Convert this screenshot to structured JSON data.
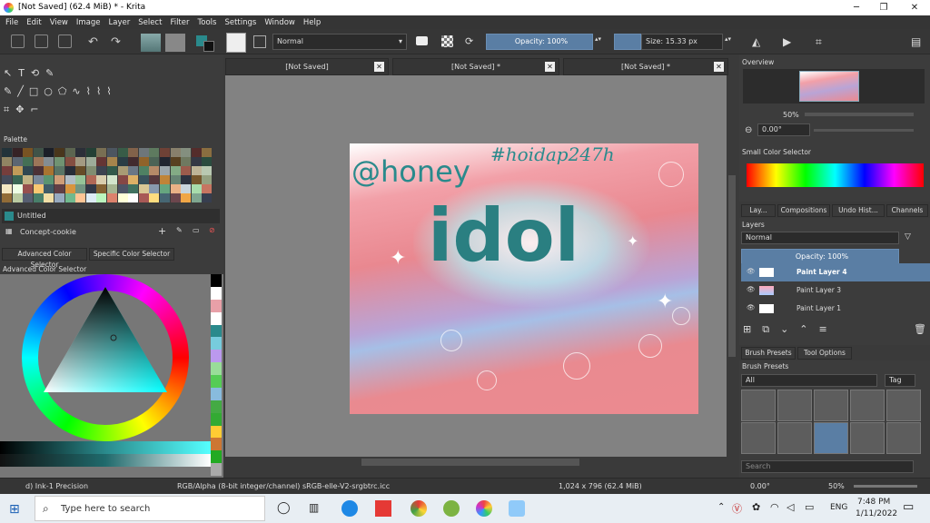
{
  "window": {
    "title": "[Not Saved]  (62.4 MiB)  * - Krita"
  },
  "menu": [
    "File",
    "Edit",
    "View",
    "Image",
    "Layer",
    "Select",
    "Filter",
    "Tools",
    "Settings",
    "Window",
    "Help"
  ],
  "toolbar": {
    "blend_mode": "Normal",
    "opacity": "Opacity: 100%",
    "size": "Size: 15.33 px"
  },
  "doc_tabs": [
    "[Not Saved]",
    "[Not Saved]  *",
    "[Not Saved]  *"
  ],
  "palette": {
    "title": "Palette",
    "item1": "Untitled",
    "item2": "Concept-cookie"
  },
  "color_selector": {
    "tab1": "Advanced Color Selector",
    "tab2": "Specific Color Selector",
    "title": "Advanced Color Selector"
  },
  "artwork": {
    "handle": "@honey",
    "hashtag": "#hoidap247h",
    "word": "idol"
  },
  "overview": {
    "title": "Overview",
    "zoom": "50%",
    "rotation": "0.00°"
  },
  "small_color": {
    "title": "Small Color Selector"
  },
  "right_tabs": [
    "Lay...",
    "Compositions",
    "Undo Hist...",
    "Channels"
  ],
  "layers": {
    "title": "Layers",
    "blend": "Normal",
    "opacity": "Opacity:  100%",
    "items": [
      "Paint Layer 4",
      "Paint Layer 3",
      "Paint Layer 1"
    ]
  },
  "brush": {
    "tab1": "Brush Presets",
    "tab2": "Tool Options",
    "title": "Brush Presets",
    "filter": "All",
    "tag": "Tag",
    "search": "Search"
  },
  "status": {
    "brush": "d) Ink-1 Precision",
    "color_model": "RGB/Alpha (8-bit integer/channel)  sRGB-elle-V2-srgbtrc.icc",
    "dims": "1,024 x 796 (62.4 MiB)",
    "rotation": "0.00°",
    "zoom": "50%"
  },
  "taskbar": {
    "search": "Type here to search",
    "lang": "ENG",
    "time": "7:48 PM",
    "date": "1/11/2022"
  },
  "colors": {
    "accent": "#5a7ea4",
    "teal": "#2a8a8c"
  }
}
